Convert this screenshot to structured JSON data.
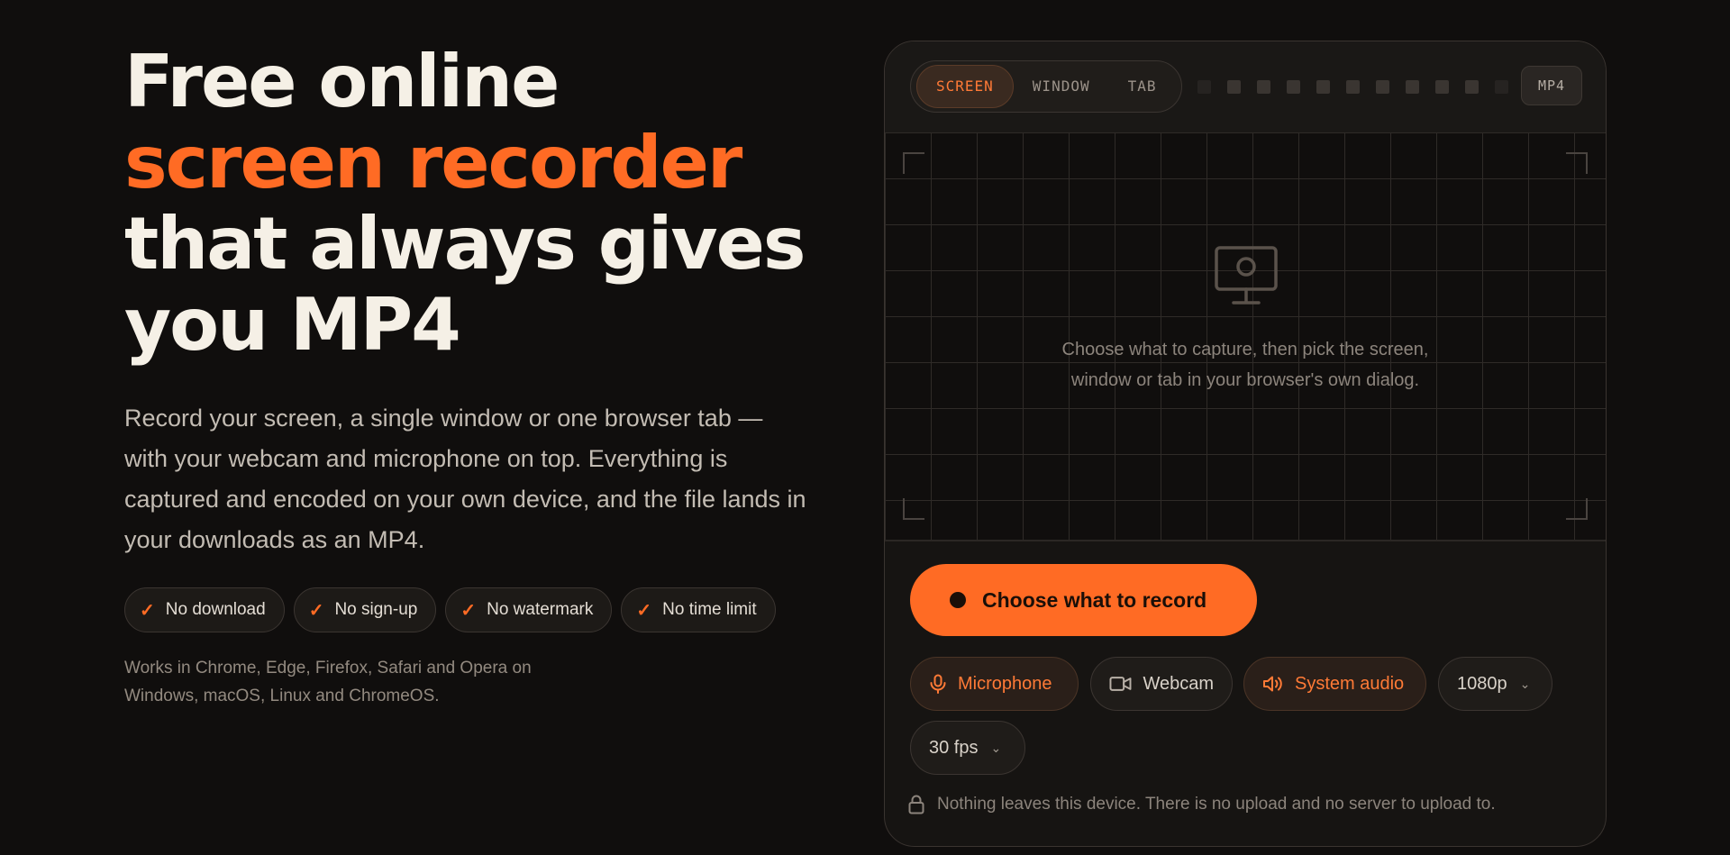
{
  "hero": {
    "headline_line1": "Free online",
    "headline_accent": "screen recorder",
    "headline_rest": "that always gives you MP4",
    "lead": "Record your screen, a single window or one browser tab — with your webcam and microphone on top. Everything is captured and encoded on your own device, and the file lands in your downloads as an MP4.",
    "features": [
      "No download",
      "No sign-up",
      "No watermark",
      "No time limit"
    ],
    "compat": "Works in Chrome, Edge, Firefox, Safari and Opera on Windows, macOS, Linux and ChromeOS."
  },
  "recorder": {
    "modes": [
      "SCREEN",
      "WINDOW",
      "TAB"
    ],
    "active_mode": "SCREEN",
    "format": "MP4",
    "stage_hint": "Choose what to capture, then pick the screen, window or tab in your browser's own dialog.",
    "record_label": "Choose what to record",
    "options": {
      "microphone": "Microphone",
      "webcam": "Webcam",
      "system_audio": "System audio",
      "resolution": "1080p",
      "fps": "30 fps"
    },
    "privacy": "Nothing leaves this device. There is no upload and no server to upload to."
  },
  "colors": {
    "accent": "#ff6b24",
    "background": "#100e0d",
    "panel": "#161412"
  },
  "icons": [
    "check-icon",
    "monitor-icon",
    "record-dot-icon",
    "microphone-icon",
    "webcam-icon",
    "speaker-icon",
    "chevron-down-icon",
    "lock-icon"
  ]
}
